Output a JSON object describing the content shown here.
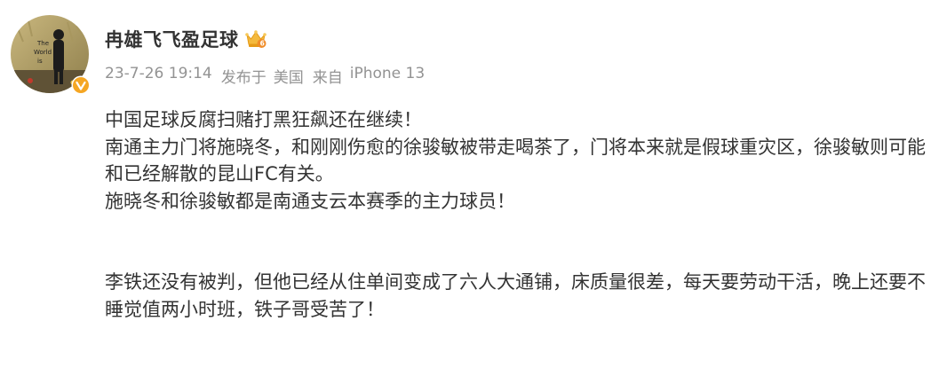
{
  "user": {
    "name": "冉雄飞飞盈足球"
  },
  "post": {
    "time": "23-7-26 19:14",
    "published_at_label": "发布于",
    "location": "美国",
    "source_label": "来自",
    "device": "iPhone 13",
    "paragraphs": [
      "中国足球反腐扫赌打黑狂飙还在继续！",
      "南通主力门将施晓冬，和刚刚伤愈的徐骏敏被带走喝茶了，门将本来就是假球重灾区，徐骏敏则可能和已经解散的昆山FC有关。",
      "施晓冬和徐骏敏都是南通支云本赛季的主力球员！",
      "",
      "李铁还没有被判，但他已经从住单间变成了六人大通铺，床质量很差，每天要劳动干活，晚上还要不睡觉值两小时班，铁子哥受苦了！"
    ]
  },
  "colors": {
    "text": "#333333",
    "meta": "#939393",
    "badge": "#F5A623"
  },
  "icons": {
    "verified": "verified-badge-icon",
    "member": "crown-icon"
  }
}
